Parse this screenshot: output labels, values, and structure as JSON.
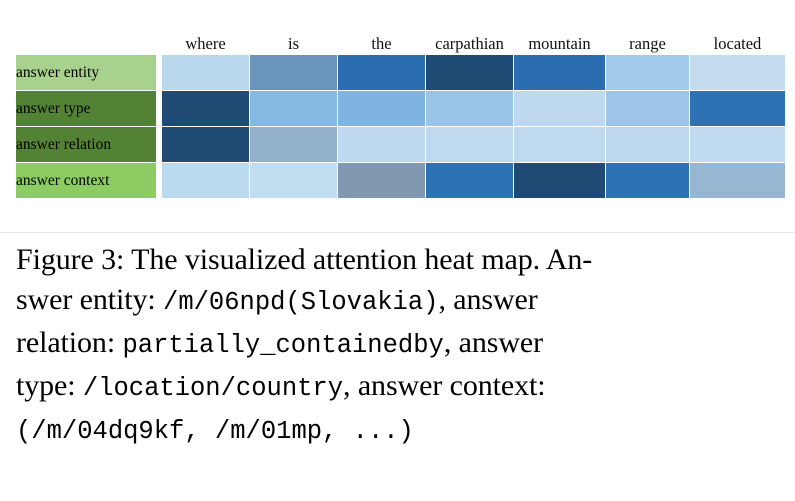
{
  "figure": {
    "columns": [
      "where",
      "is",
      "the",
      "carpathian",
      "mountain",
      "range",
      "located"
    ],
    "rows": [
      {
        "label": "answer entity",
        "label_color": "#a9d18e"
      },
      {
        "label": "answer type",
        "label_color": "#548235"
      },
      {
        "label": "answer relation",
        "label_color": "#548235"
      },
      {
        "label": "answer context",
        "label_color": "#8ccc63"
      }
    ],
    "cell_grid_colors": [
      [
        "#bad8ec",
        "#6b94bd",
        "#2a6db0",
        "#1e4a74",
        "#2a6db0",
        "#a2cbeb",
        "#c4dcf0"
      ],
      [
        "#1e4a74",
        "#85b8e2",
        "#7fb3e0",
        "#9ac4e6",
        "#bed9ef",
        "#9cc5e8",
        "#2c72b5"
      ],
      [
        "#1e4a74",
        "#93b1cc",
        "#bed9ef",
        "#bfd9ef",
        "#bfd9ef",
        "#bdd8ee",
        "#c0daef"
      ],
      [
        "#badaef",
        "#c2dcf0",
        "#8198b1",
        "#2c72b5",
        "#1e4a74",
        "#2c72b5",
        "#97b6d2"
      ]
    ],
    "grid_border_color": "#ffffff",
    "background_color": "#ffffff"
  },
  "chart_data": {
    "type": "heatmap",
    "title": "The visualized attention heat map",
    "xlabel": "",
    "ylabel": "",
    "x_tick_labels": [
      "where",
      "is",
      "the",
      "carpathian",
      "mountain",
      "range",
      "located"
    ],
    "y_tick_labels": [
      "answer entity",
      "answer type",
      "answer relation",
      "answer context"
    ],
    "grid": false,
    "legend": "none",
    "colormap": "Blues",
    "value_range": [
      0.0,
      1.0
    ],
    "series": [
      {
        "name": "answer entity",
        "values": [
          0.22,
          0.55,
          0.78,
          0.95,
          0.78,
          0.33,
          0.18
        ]
      },
      {
        "name": "answer type",
        "values": [
          0.95,
          0.42,
          0.45,
          0.38,
          0.22,
          0.36,
          0.72
        ]
      },
      {
        "name": "answer relation",
        "values": [
          0.95,
          0.48,
          0.18,
          0.18,
          0.18,
          0.19,
          0.18
        ]
      },
      {
        "name": "answer context",
        "values": [
          0.22,
          0.18,
          0.52,
          0.72,
          0.95,
          0.72,
          0.45
        ]
      }
    ],
    "annotations": [
      "answer entity: /m/06npd(Slovakia)",
      "answer relation: partially_containedby",
      "answer type: /location/country",
      "answer context: (/m/04dq9kf, /m/01mp, ...)"
    ]
  },
  "caption": {
    "line1_a": "Figure 3: The visualized attention heat map. An-",
    "line2_a": "swer entity: ",
    "line2_mono": "/m/06npd(Slovakia)",
    "line2_b": ", answer",
    "line3_a": "relation: ",
    "line3_mono": "partially_containedby",
    "line3_b": ", answer",
    "line4_a": "type: ",
    "line4_mono": "/location/country",
    "line4_b": ", answer context:",
    "line5_mono": "(/m/04dq9kf, /m/01mp, ...)"
  }
}
